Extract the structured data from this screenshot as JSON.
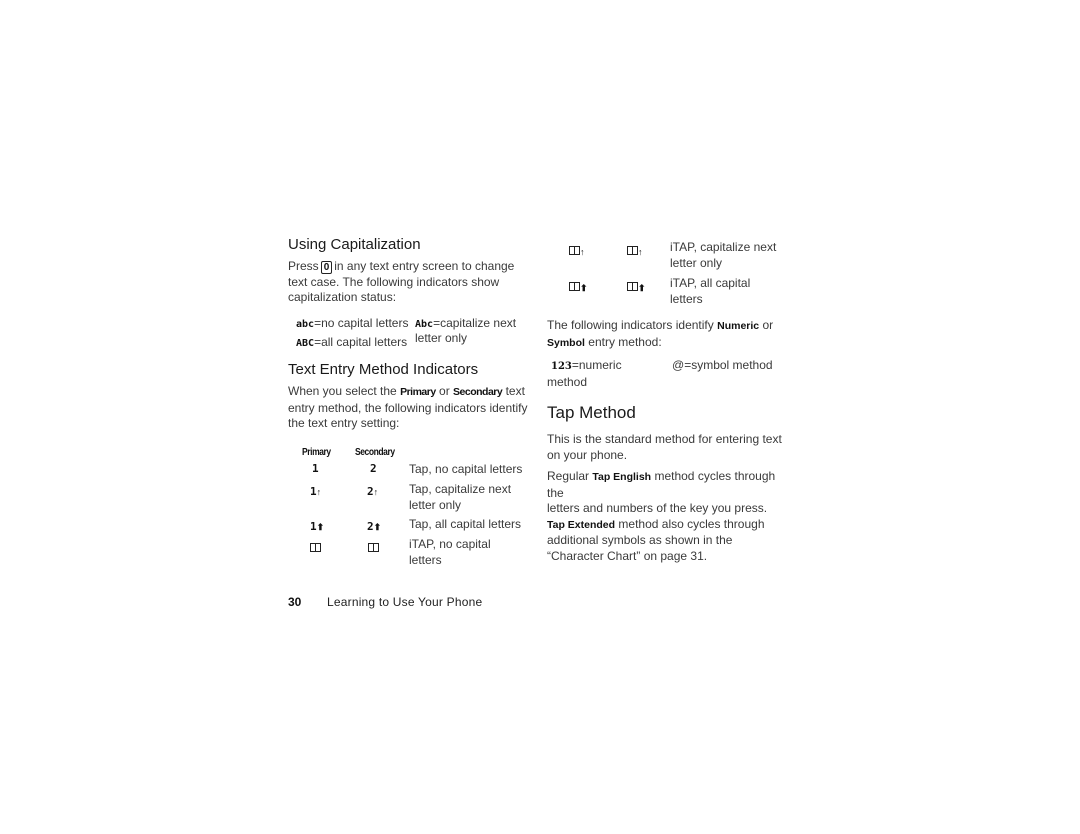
{
  "left_column": {
    "capitalization": {
      "heading": "Using Capitalization",
      "para_pre": "Press",
      "key_label": "0",
      "para_post_line1": "in any text entry screen to change",
      "para_line2": "text case. The following indicators show",
      "para_line3": "capitalization status:",
      "indicators": [
        {
          "glyph": "abc",
          "text": "=no capital letters"
        },
        {
          "glyph": "Abc",
          "text": "=capitalize next"
        },
        {
          "glyph": "ABC",
          "text": "=all capital letters"
        },
        {
          "glyph": "",
          "text": "letter only"
        }
      ]
    },
    "text_entry": {
      "heading": "Text Entry Method Indicators",
      "para_l1_a": "When you select the",
      "para_l1_b": "Primary",
      "para_l1_c": "or",
      "para_l1_d": "Secondary",
      "para_l1_e": "text",
      "para_l2": "entry method, the following indicators identify",
      "para_l3": "the text entry setting:",
      "col_primary": "Primary",
      "col_secondary": "Secondary",
      "rows": [
        {
          "primary": "1",
          "secondary": "2",
          "arrow": "",
          "desc": [
            "Tap, no capital letters"
          ]
        },
        {
          "primary": "1",
          "secondary": "2",
          "arrow": "↑",
          "desc": [
            "Tap, capitalize next",
            "letter only"
          ]
        },
        {
          "primary": "1",
          "secondary": "2",
          "arrow": "⬆",
          "desc": [
            "Tap, all capital letters"
          ]
        },
        {
          "primary": "itap-book",
          "secondary": "itap-book",
          "arrow": "",
          "desc": [
            "iTAP, no capital",
            "letters"
          ]
        }
      ]
    }
  },
  "right_column": {
    "itap_rows": [
      {
        "arrow": "↑",
        "desc": [
          "iTAP, capitalize next",
          "letter only"
        ]
      },
      {
        "arrow": "⬆",
        "desc": [
          "iTAP, all capital",
          "letters"
        ]
      }
    ],
    "numeric": {
      "para_l1_a": "The following indicators identify",
      "para_l1_b": "Numeric",
      "para_l1_c": "or",
      "para_l2_a": "Symbol",
      "para_l2_b": "entry method:",
      "numeric_glyph": "123",
      "numeric_text": "=numeric",
      "numeric_text2": "method",
      "symbol_glyph": "@",
      "symbol_text": "=symbol method"
    },
    "tap_method": {
      "heading": "Tap Method",
      "para1_l1": "This is the standard method for entering text",
      "para1_l2": "on your phone.",
      "para2_l1_a": "Regular",
      "para2_l1_b": "Tap English",
      "para2_l1_c": "method cycles through the",
      "para2_l2": "letters and numbers of the key you press.",
      "para2_l3_a": "Tap Extended",
      "para2_l3_b": "method also cycles through",
      "para2_l4": "additional symbols as shown in the",
      "para2_l5": "“Character Chart” on page 31."
    }
  },
  "footer": {
    "page_number": "30",
    "section_title": "Learning to Use Your Phone"
  }
}
